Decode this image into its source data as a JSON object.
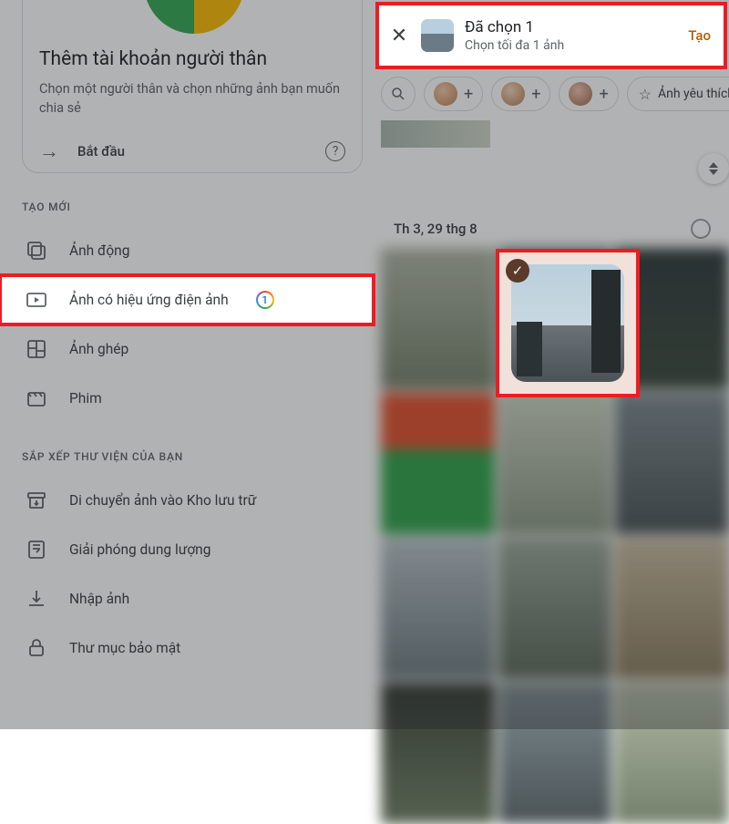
{
  "family_card": {
    "title": "Thêm tài khoản người thân",
    "subtitle": "Chọn một người thân và chọn những ảnh bạn muốn chia sẻ",
    "start_label": "Bắt đầu"
  },
  "sections": {
    "create_label": "TẠO MỚI",
    "organize_label": "SẮP XẾP THƯ VIỆN CỦA BẠN"
  },
  "create_items": {
    "animation": "Ảnh động",
    "cinematic": "Ảnh có hiệu ứng điện ảnh",
    "cinematic_badge": "1",
    "collage": "Ảnh ghép",
    "movie": "Phim"
  },
  "organize_items": {
    "archive": "Di chuyển ảnh vào Kho lưu trữ",
    "freeup": "Giải phóng dung lượng",
    "import": "Nhập ảnh",
    "locked": "Thư mục bảo mật"
  },
  "selection_bar": {
    "title": "Đã chọn 1",
    "subtitle": "Chọn tối đa 1 ảnh",
    "create": "Tạo"
  },
  "chips": {
    "favorites": "Ảnh yêu thích"
  },
  "date_header": "Th 3, 29 thg 8"
}
